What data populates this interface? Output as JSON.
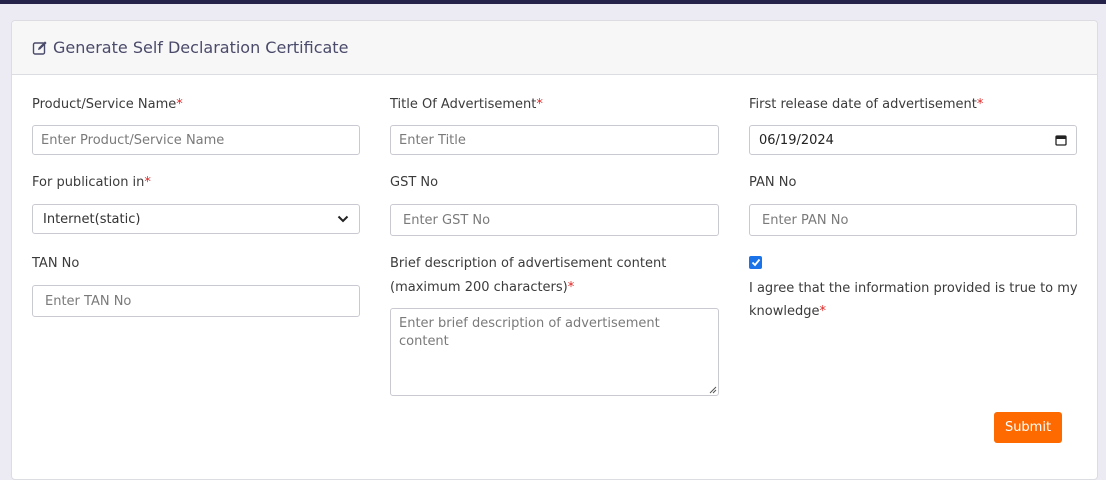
{
  "header": {
    "title": "Generate Self Declaration Certificate",
    "icon": "edit-icon"
  },
  "form": {
    "product_name": {
      "label": "Product/Service Name",
      "required_mark": "*",
      "placeholder": "Enter Product/Service Name",
      "value": ""
    },
    "title": {
      "label": "Title Of Advertisement",
      "required_mark": "*",
      "placeholder": "Enter Title",
      "value": ""
    },
    "release_date": {
      "label": "First release date of advertisement",
      "required_mark": "*",
      "value": "06/19/2024",
      "icon": "calendar-icon"
    },
    "publication": {
      "label": "For publication in",
      "required_mark": "*",
      "selected": "Internet(static)",
      "icon": "chevron-down-icon"
    },
    "gst": {
      "label": "GST No",
      "placeholder": "Enter GST No",
      "value": ""
    },
    "pan": {
      "label": "PAN No",
      "placeholder": "Enter PAN No",
      "value": ""
    },
    "tan": {
      "label": "TAN No",
      "placeholder": "Enter TAN No",
      "value": ""
    },
    "description": {
      "label_line1": "Brief description of advertisement content",
      "label_line2": "(maximum 200 characters)",
      "required_mark": "*",
      "placeholder": "Enter brief description of advertisement content",
      "value": ""
    },
    "agreement": {
      "checked": true,
      "text": "I agree that the information provided is true to my knowledge",
      "required_mark": "*"
    },
    "submit_label": "Submit"
  },
  "colors": {
    "accent": "#ff6a00",
    "required": "#e02424",
    "checkbox": "#1a73e8",
    "topbar": "#25234a"
  }
}
